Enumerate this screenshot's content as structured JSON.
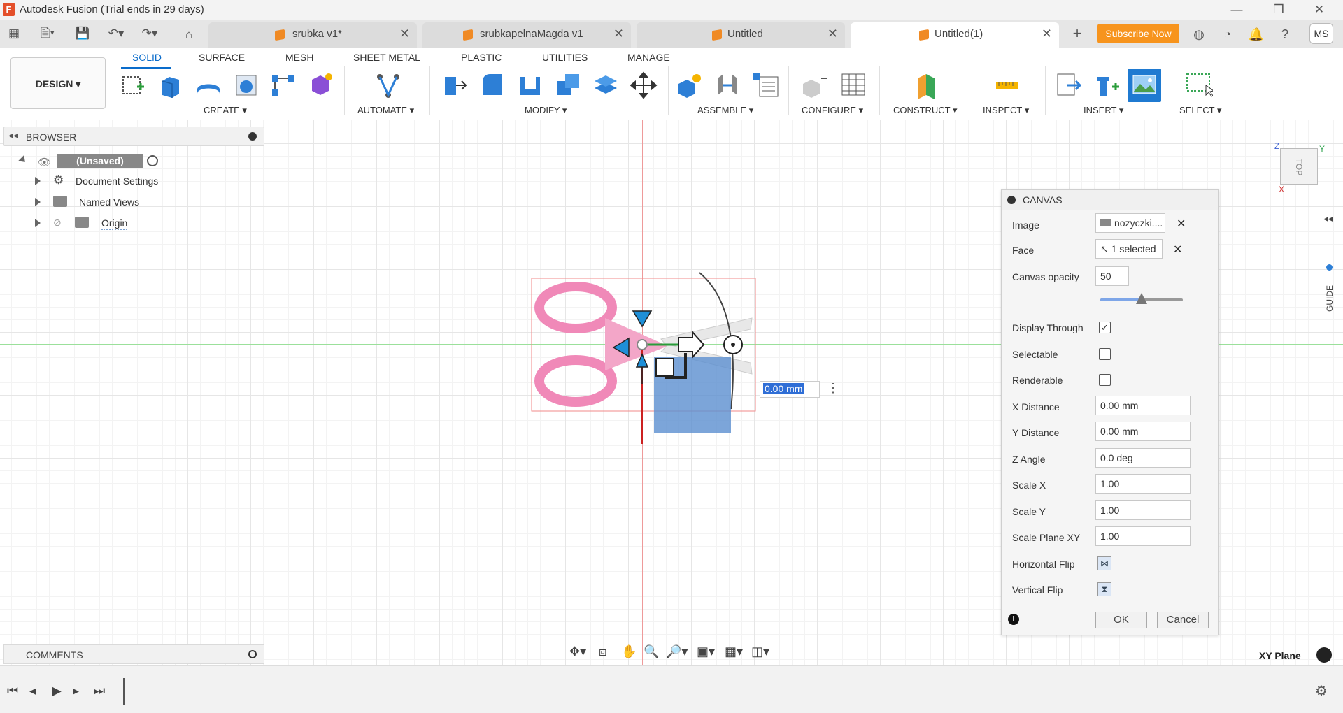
{
  "window": {
    "title": "Autodesk Fusion (Trial ends in 29 days)",
    "logo_letter": "F"
  },
  "tabs": [
    {
      "label": "srubka v1*"
    },
    {
      "label": "srubkapelnaMagda v1"
    },
    {
      "label": "Untitled"
    },
    {
      "label": "Untitled(1)"
    }
  ],
  "header": {
    "subscribe": "Subscribe Now",
    "avatar": "MS"
  },
  "workspace": {
    "label": "DESIGN ▾"
  },
  "ws_tabs": [
    "SOLID",
    "SURFACE",
    "MESH",
    "SHEET METAL",
    "PLASTIC",
    "UTILITIES",
    "MANAGE"
  ],
  "groups": [
    "CREATE ▾",
    "AUTOMATE ▾",
    "MODIFY ▾",
    "ASSEMBLE ▾",
    "CONFIGURE ▾",
    "CONSTRUCT ▾",
    "INSPECT ▾",
    "INSERT ▾",
    "SELECT ▾"
  ],
  "browser": {
    "title": "BROWSER",
    "root": "(Unsaved)",
    "items": [
      "Document Settings",
      "Named Views",
      "Origin"
    ]
  },
  "comments": {
    "title": "COMMENTS"
  },
  "viewport": {
    "distance_value": "0.00 mm",
    "plane": "XY Plane",
    "viewcube": "TOP",
    "guide": "GUIDE",
    "axis_z": "Z",
    "axis_y": "Y",
    "axis_x": "X"
  },
  "canvas_dialog": {
    "title": "CANVAS",
    "image_label": "Image",
    "image_value": "nozyczki....",
    "face_label": "Face",
    "face_value": "1 selected",
    "opacity_label": "Canvas opacity",
    "opacity_value": "50",
    "opacity_fraction": 0.5,
    "display_through_label": "Display Through",
    "display_through": true,
    "selectable_label": "Selectable",
    "selectable": false,
    "renderable_label": "Renderable",
    "renderable": false,
    "x_distance_label": "X Distance",
    "x_distance": "0.00 mm",
    "y_distance_label": "Y Distance",
    "y_distance": "0.00 mm",
    "z_angle_label": "Z Angle",
    "z_angle": "0.0 deg",
    "scale_x_label": "Scale X",
    "scale_x": "1.00",
    "scale_y_label": "Scale Y",
    "scale_y": "1.00",
    "scale_plane_label": "Scale Plane XY",
    "scale_plane": "1.00",
    "hflip_label": "Horizontal Flip",
    "vflip_label": "Vertical Flip",
    "ok": "OK",
    "cancel": "Cancel"
  },
  "colors": {
    "accent": "#0a6ccb",
    "subscribe": "#f7941d",
    "tab_cube": "#f08a24",
    "selection_blue": "#5b8fd0"
  }
}
